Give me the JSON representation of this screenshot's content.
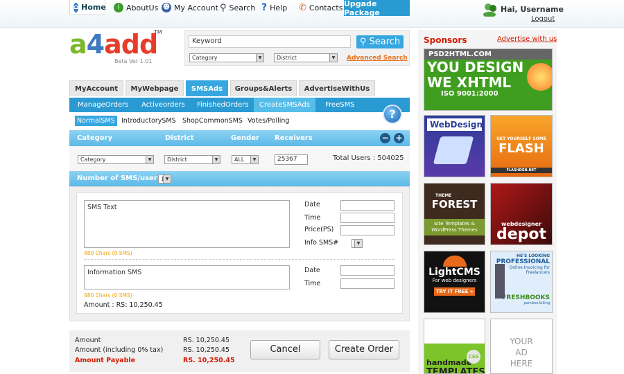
{
  "nav": {
    "home": "Home",
    "about": "AboutUs",
    "account": "My Account",
    "search": "Search",
    "help": "Help",
    "contacts": "Contacts",
    "upgrade": "Upgade Package"
  },
  "user": {
    "greeting": "Hai, Username",
    "logout": "Logout"
  },
  "logo": {
    "a": "a",
    "four": "4",
    "add": "add",
    "tm": "TM",
    "beta": "Beta Ver 1.01"
  },
  "search": {
    "keyword": "Keyword",
    "button": "Search",
    "category": "Category",
    "district": "District",
    "advanced": "Advanced Search"
  },
  "tabs": [
    "MyAccount",
    "MyWebpage",
    "SMSAds",
    "Groups&Alerts",
    "AdvertiseWithUs"
  ],
  "subtabs": [
    "ManageOrders",
    "Activeorders",
    "FinishedOrders",
    "CreateSMSAds",
    "FreeSMS"
  ],
  "subtabs3": [
    "NormalSMS",
    "IntroductorySMS",
    "ShopCommonSMS",
    "Votes/Polling"
  ],
  "help_glyph": "?",
  "filters": {
    "h_category": "Category",
    "h_district": "District",
    "h_gender": "Gender",
    "h_receivers": "Receivers",
    "category": "Category",
    "district": "District",
    "gender": "ALL",
    "receivers": "25367",
    "total_users": "Total Users : 504025",
    "minus": "−",
    "plus": "+"
  },
  "num_sms": {
    "label": "Number of SMS/user",
    "value": "1"
  },
  "form": {
    "sms_text": "SMS Text",
    "chars1": "480 Chars (0 SMS)",
    "date": "Date",
    "time": "Time",
    "price": "Price(PS)",
    "info_sms": "Info SMS#",
    "info_text": "Information SMS",
    "chars2": "480 Chars (0 SMS)",
    "date2": "Date",
    "time2": "Time",
    "amount": "Amount : RS:  10,250.45"
  },
  "totals": {
    "amount": "Amount",
    "amount_val": "RS. 10,250.45",
    "amount_tax": "Amount (including 0% tax)",
    "amount_tax_val": "RS. 10,250.45",
    "payable": "Amount Payable",
    "payable_val": "RS. 10,250.45",
    "cancel": "Cancel",
    "create": "Create Order"
  },
  "sidebar": {
    "title": "Sponsors",
    "advertise": "Advertise with us",
    "ad1": {
      "site": "PSD2HTML.COM",
      "l1": "YOU DESIGN",
      "l2": "WE XHTML",
      "l3": "ISO 9001:2000"
    },
    "ad2": "WebDesigners",
    "ad3": {
      "l1": "GET YOURSELF SOME",
      "l2": "FLASH",
      "l3": "FLASHDEN.NET"
    },
    "ad4": {
      "l1": "THEME",
      "l2": "FOREST",
      "l3": "Site Templates &",
      "l4": "WordPress Themes"
    },
    "ad5": {
      "l1": "webdesigner",
      "l2": "depot"
    },
    "ad6": {
      "l1": "LightCMS",
      "l2": "For web designers",
      "l3": "TRY IT FREE »"
    },
    "ad7": {
      "l1": "HE'S LOOKING",
      "l2": "PROFESSIONAL",
      "l3": "Online Invoicing for",
      "l4": "Freelancers",
      "l5": "FRESHBOOKS",
      "l6": "painless billing"
    },
    "ad8": {
      "l1": "handmade",
      "l2": "TEMPLATES",
      "l3": "CSS"
    },
    "ad9": {
      "l1": "YOUR",
      "l2": "AD",
      "l3": "HERE"
    }
  },
  "colors": {
    "accent": "#2a9ad2",
    "light_accent": "#5cb9e7",
    "red": "#d41a00",
    "orange": "#e8731e"
  }
}
